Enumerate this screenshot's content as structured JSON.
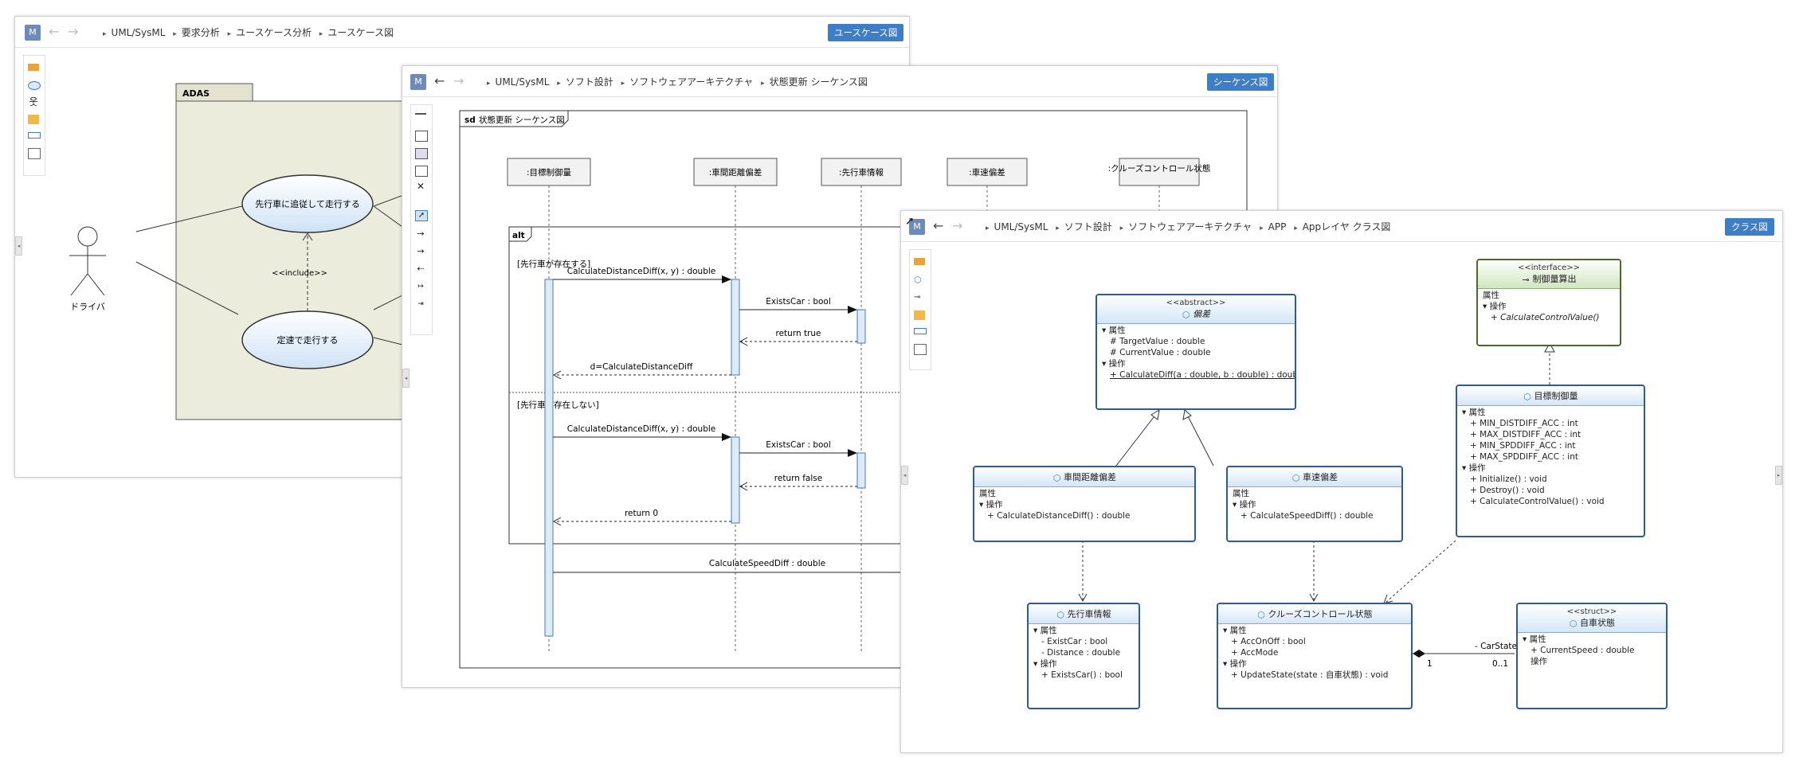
{
  "usecase_window": {
    "breadcrumb": [
      "UML/SysML",
      "要求分析",
      "ユースケース分析",
      "ユースケース図"
    ],
    "diagram_type_button": "ユースケース図",
    "package_name": "ADAS",
    "actor": "ドライバ",
    "usecases": [
      "先行車に追従して走行する",
      "定速で走行する"
    ],
    "include_label": "<<include>>"
  },
  "sequence_window": {
    "breadcrumb": [
      "UML/SysML",
      "ソフト設計",
      "ソフトウェアアーキテクチャ",
      "状態更新 シーケンス図"
    ],
    "diagram_type_button": "シーケンス図",
    "frame_kind": "sd",
    "frame_title": "状態更新 シーケンス図",
    "lifelines": [
      ":目標制御量",
      ":車間距離偏差",
      ":先行車情報",
      ":車速偏差",
      ":クルーズコントロール状態"
    ],
    "alt_label": "alt",
    "guard_1": "[先行車が存在する]",
    "guard_2": "[先行車が存在しない]",
    "messages": [
      "CalculateDistanceDiff(x, y) : double",
      "ExistsCar : bool",
      "return true",
      "d=CalculateDistanceDiff",
      "CalculateDistanceDiff(x, y) : double",
      "ExistsCar : bool",
      "return false",
      "return 0",
      "CalculateSpeedDiff : double"
    ]
  },
  "class_window": {
    "breadcrumb": [
      "UML/SysML",
      "ソフト設計",
      "ソフトウェアアーキテクチャ",
      "APP",
      "Appレイヤ クラス図"
    ],
    "diagram_type_button": "クラス図",
    "section_attributes": "属性",
    "section_operations": "操作",
    "classes": {
      "deviation": {
        "stereotype": "<<abstract>>",
        "name": "偏差",
        "attributes": [
          "# TargetValue : double",
          "# CurrentValue : double"
        ],
        "operations": [
          "+ CalculateDiff(a : double, b : double) : double"
        ]
      },
      "control_iface": {
        "stereotype": "<<interface>>",
        "name": "制御量算出",
        "operations": [
          "+ CalculateControlValue()"
        ]
      },
      "target_control": {
        "name": "目標制御量",
        "attributes": [
          "+ MIN_DISTDIFF_ACC : int",
          "+ MAX_DISTDIFF_ACC : int",
          "+ MIN_SPDDIFF_ACC : int",
          "+ MAX_SPDDIFF_ACC : int"
        ],
        "operations": [
          "+ Initialize() : void",
          "+ Destroy() : void",
          "+ CalculateControlValue() : void"
        ]
      },
      "distance_dev": {
        "name": "車間距離偏差",
        "operations": [
          "+ CalculateDistanceDiff() : double"
        ]
      },
      "speed_dev": {
        "name": "車速偏差",
        "operations": [
          "+ CalculateSpeedDiff() : double"
        ]
      },
      "lead_car": {
        "name": "先行車情報",
        "attributes": [
          "- ExistCar : bool",
          "- Distance : double"
        ],
        "operations": [
          "+ ExistsCar() : bool"
        ]
      },
      "cruise_state": {
        "name": "クルーズコントロール状態",
        "attributes": [
          "+ AccOnOff : bool",
          "+ AccMode"
        ],
        "operations": [
          "+ UpdateState(state : 自車状態) : void"
        ]
      },
      "own_state": {
        "stereotype": "<<struct>>",
        "name": "自車状態",
        "attributes": [
          "+ CurrentSpeed : double"
        ]
      }
    },
    "association": {
      "role": "- CarState",
      "mult_left": "1",
      "mult_right": "0..1"
    }
  },
  "common": {
    "m_button": "M"
  },
  "colors": {
    "accent_button": "#3d7ec7",
    "class_border": "#2b5a9e",
    "interface_border": "#4a6a2a",
    "lifeline_activation": "#9ec5ea"
  }
}
